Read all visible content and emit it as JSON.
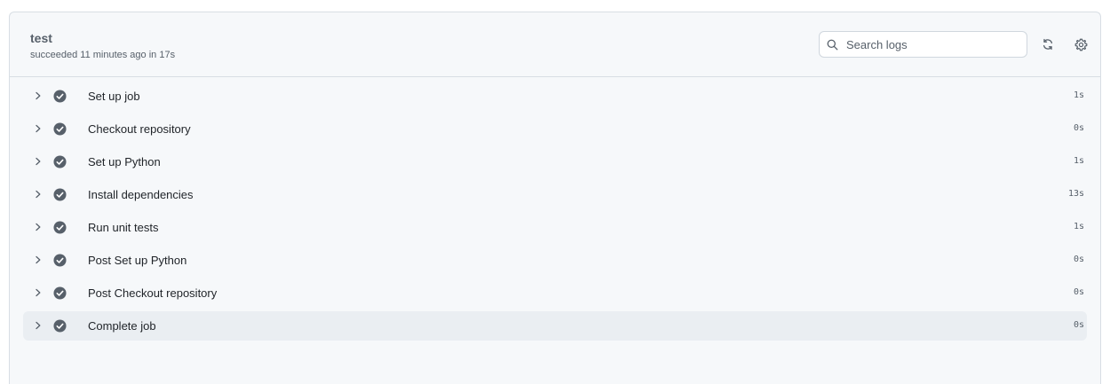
{
  "job": {
    "title": "test",
    "subtitle": "succeeded 11 minutes ago in 17s"
  },
  "search": {
    "placeholder": "Search logs",
    "value": ""
  },
  "icons": {
    "search": "search-icon",
    "refresh": "refresh-icon",
    "settings": "gear-icon",
    "expand": "chevron-right-icon",
    "status": "check-circle-icon"
  },
  "colors": {
    "status_success": "#57606a",
    "panel_bg": "#f6f8fa",
    "active_row_bg": "#eaeef2"
  },
  "steps": [
    {
      "name": "Set up job",
      "duration": "1s"
    },
    {
      "name": "Checkout repository",
      "duration": "0s"
    },
    {
      "name": "Set up Python",
      "duration": "1s"
    },
    {
      "name": "Install dependencies",
      "duration": "13s"
    },
    {
      "name": "Run unit tests",
      "duration": "1s"
    },
    {
      "name": "Post Set up Python",
      "duration": "0s"
    },
    {
      "name": "Post Checkout repository",
      "duration": "0s"
    },
    {
      "name": "Complete job",
      "duration": "0s"
    }
  ]
}
